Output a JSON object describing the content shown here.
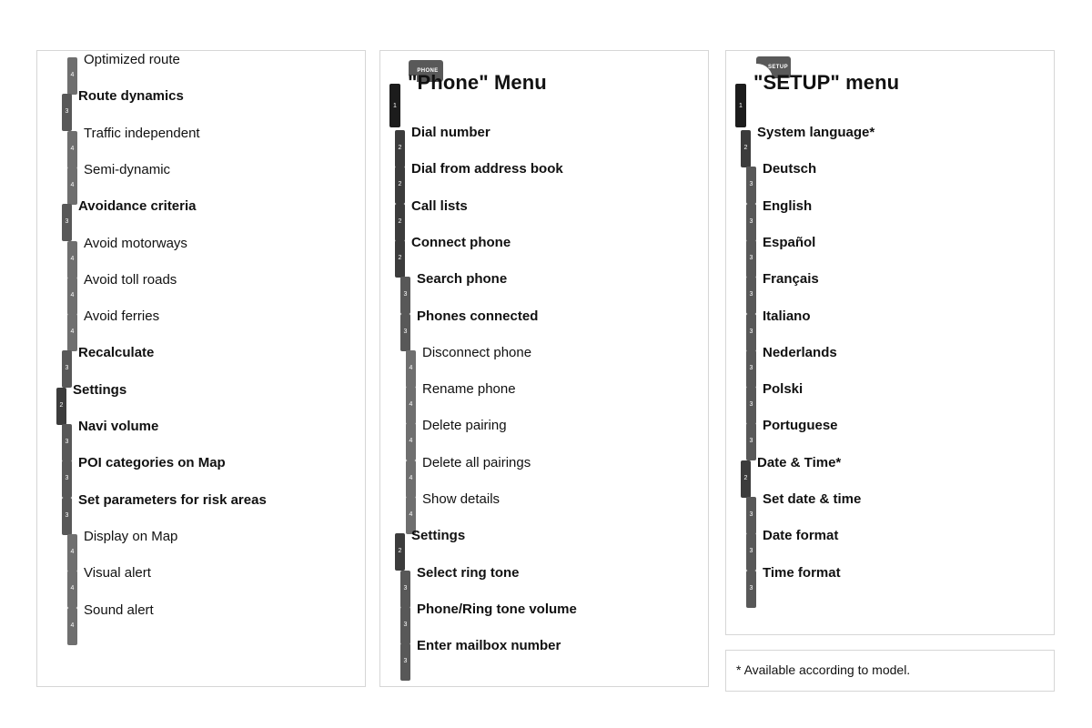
{
  "footnote": {
    "text": "* Available according to model."
  },
  "columns": [
    {
      "id": "navigation-menu",
      "name": "navigation-menu-column",
      "badge": null,
      "title": null,
      "items": [
        {
          "level": 4,
          "label": "Optimized route"
        },
        {
          "level": 3,
          "label": "Route dynamics"
        },
        {
          "level": 4,
          "label": "Traffic independent"
        },
        {
          "level": 4,
          "label": "Semi-dynamic"
        },
        {
          "level": 3,
          "label": "Avoidance criteria"
        },
        {
          "level": 4,
          "label": "Avoid motorways"
        },
        {
          "level": 4,
          "label": "Avoid toll roads"
        },
        {
          "level": 4,
          "label": "Avoid ferries"
        },
        {
          "level": 3,
          "label": "Recalculate"
        },
        {
          "level": 2,
          "label": "Settings"
        },
        {
          "level": 3,
          "label": "Navi volume"
        },
        {
          "level": 3,
          "label": "POI categories on Map"
        },
        {
          "level": 3,
          "label": "Set parameters for risk areas"
        },
        {
          "level": 4,
          "label": "Display on Map"
        },
        {
          "level": 4,
          "label": "Visual alert"
        },
        {
          "level": 4,
          "label": "Sound alert"
        }
      ]
    },
    {
      "id": "phone-menu",
      "name": "phone-menu-column",
      "badge": {
        "icon": "phone-badge-icon",
        "label": "PHONE"
      },
      "title": {
        "level": 1,
        "label": "\"Phone\" Menu"
      },
      "items": [
        {
          "level": 2,
          "label": "Dial number"
        },
        {
          "level": 2,
          "label": "Dial from address book"
        },
        {
          "level": 2,
          "label": "Call lists"
        },
        {
          "level": 2,
          "label": "Connect phone"
        },
        {
          "level": 3,
          "label": "Search phone"
        },
        {
          "level": 3,
          "label": "Phones connected"
        },
        {
          "level": 4,
          "label": "Disconnect phone"
        },
        {
          "level": 4,
          "label": "Rename phone"
        },
        {
          "level": 4,
          "label": "Delete pairing"
        },
        {
          "level": 4,
          "label": "Delete all pairings"
        },
        {
          "level": 4,
          "label": "Show details"
        },
        {
          "level": 2,
          "label": "Settings"
        },
        {
          "level": 3,
          "label": "Select ring tone"
        },
        {
          "level": 3,
          "label": "Phone/Ring tone volume"
        },
        {
          "level": 3,
          "label": "Enter mailbox number"
        }
      ]
    },
    {
      "id": "setup-menu",
      "name": "setup-menu-column",
      "badge": {
        "icon": "setup-badge-icon",
        "label": "SETUP"
      },
      "title": {
        "level": 1,
        "label": "\"SETUP\" menu"
      },
      "items": [
        {
          "level": 2,
          "label": "System language*"
        },
        {
          "level": 3,
          "label": "Deutsch"
        },
        {
          "level": 3,
          "label": "English"
        },
        {
          "level": 3,
          "label": "Español"
        },
        {
          "level": 3,
          "label": "Français"
        },
        {
          "level": 3,
          "label": "Italiano"
        },
        {
          "level": 3,
          "label": "Nederlands"
        },
        {
          "level": 3,
          "label": "Polski"
        },
        {
          "level": 3,
          "label": "Portuguese"
        },
        {
          "level": 2,
          "label": "Date & Time*"
        },
        {
          "level": 3,
          "label": "Set date & time"
        },
        {
          "level": 3,
          "label": "Date format"
        },
        {
          "level": 3,
          "label": "Time format"
        }
      ]
    }
  ],
  "colors": {
    "level1": "#1c1c1c",
    "level2": "#3c3c3c",
    "level3": "#585858",
    "level4": "#6f6f6f",
    "panel_border": "#d6d6d6",
    "text": "#111111",
    "badge": "#595959"
  }
}
